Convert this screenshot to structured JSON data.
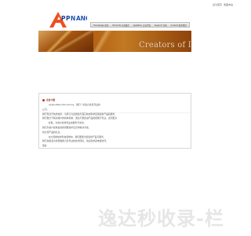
{
  "header": {
    "links": [
      "设为首页",
      "收藏本站"
    ]
  },
  "nav": {
    "items": [
      {
        "label": "Homepage 首页"
      },
      {
        "label": "Products 产品展示"
      },
      {
        "label": "AppNano 企业介绍"
      },
      {
        "label": "Support 合商"
      },
      {
        "label": "Contact 联系我们"
      }
    ]
  },
  "banner": {
    "text": "Creators of Innovative"
  },
  "content": {
    "title": "企业介绍",
    "lines": [
      "AppliedNanoStructures，我们一家新兴并且专业的",
      "公司。",
      "我们专注于纳米技术，为原子力显微镜与其它纳米科学应用提供产品和服务。",
      "我们致力于解决用户的各种需求，通过不断改进产品的质量与专业，达到更高",
      "标准，为客户提供专业的服务与支持。",
      "我们为客户提供最新的测量技术及合作解决方案。",
      "找全部产品的信息，",
      "在全部的纳米科技领域中，我们都能为您提供产品与服务，",
      "我们具备强大的研发能力及专业的技术团队，欢迎您的来电或访问。",
      "更多"
    ]
  },
  "watermark": {
    "text": "逸达秒收录-栏"
  },
  "colors": {
    "banner": "#a4520f",
    "title": "#7a0d0d",
    "accent": "#c22c2c"
  },
  "icons": {
    "logo": "appnano-logo",
    "bullet": "red-dot-icon"
  }
}
